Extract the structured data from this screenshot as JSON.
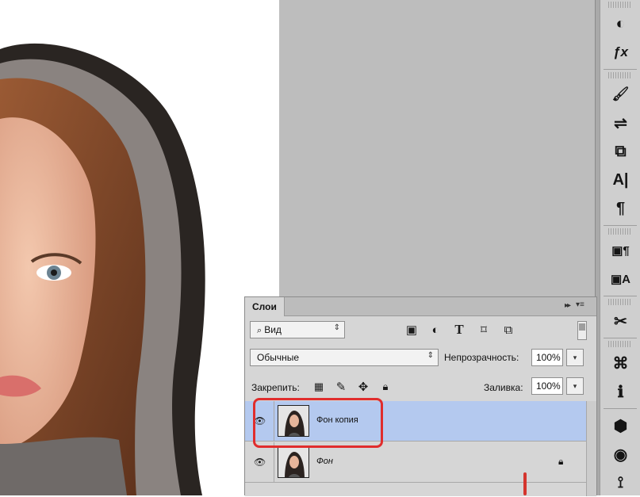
{
  "layers_panel": {
    "tab_label": "Слои",
    "collapse_glyph": "▸▸",
    "menu_glyph": "▾≡",
    "filter_kind": "Вид",
    "blend_mode": "Обычные",
    "opacity_label": "Непрозрачность:",
    "opacity_value": "100%",
    "lock_label": "Закрепить:",
    "fill_label": "Заливка:",
    "fill_value": "100%",
    "layers": [
      {
        "name": "Фон копия",
        "selected": true
      },
      {
        "name": "Фон",
        "selected": false,
        "locked": true
      }
    ]
  },
  "tool_strip": {
    "icons": [
      "adjustments-icon",
      "fx-icon",
      "brush-presets-icon",
      "brush-settings-icon",
      "clone-source-icon",
      "character-icon",
      "paragraph-icon",
      "character-styles-icon",
      "paragraph-styles-icon",
      "tool-presets-icon",
      "libraries-icon",
      "info-icon",
      "3d-icon",
      "materials-icon",
      "scene-icon"
    ],
    "glyphs": [
      "◐",
      "ƒx",
      "🖌",
      "⇌",
      "⧉",
      "A|",
      "¶",
      "▣¶",
      "▣A",
      "✂",
      "⌘",
      "ℹ",
      "⬢",
      "◉",
      "⟟"
    ]
  },
  "colors": {
    "selection": "#b4c9ef",
    "highlight_annotation": "#e02d2d",
    "pasteboard": "#bdbdbd"
  }
}
